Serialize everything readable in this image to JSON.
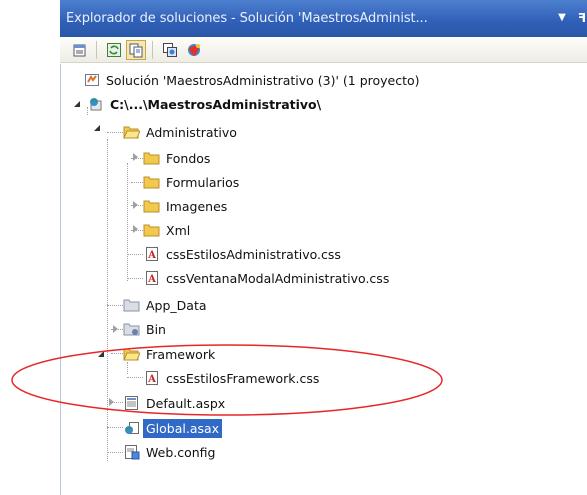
{
  "window": {
    "title": "Explorador de soluciones - Solución 'MaestrosAdminist...",
    "dropdown_icon": "dropdown-arrow-icon",
    "pin_icon": "pin-icon",
    "close_icon": "close-icon"
  },
  "toolbar": {
    "buttons": [
      {
        "icon": "properties-icon"
      },
      {
        "icon": "refresh-icon"
      },
      {
        "icon": "show-all-files-icon",
        "pressed": true
      },
      {
        "icon": "copy-website-icon"
      },
      {
        "icon": "asp-net-configuration-icon"
      }
    ]
  },
  "tree": {
    "solution": "Solución 'MaestrosAdministrativo (3)'  (1 proyecto)",
    "project": "C:\\...\\MaestrosAdministrativo\\",
    "administrativo": "Administrativo",
    "fondos": "Fondos",
    "formularios": "Formularios",
    "imagenes": "Imagenes",
    "xml": "Xml",
    "css_estilos_admin": "cssEstilosAdministrativo.css",
    "css_ventana_modal": "cssVentanaModalAdministrativo.css",
    "app_data": "App_Data",
    "bin": "Bin",
    "framework": "Framework",
    "css_estilos_framework": "cssEstilosFramework.css",
    "default_aspx": "Default.aspx",
    "global_asax": "Global.asax",
    "web_config": "Web.config"
  },
  "colors": {
    "titlebar": "#3a6cc4",
    "selection": "#3169c6",
    "annotation": "#e8262a",
    "folder": "#f2c94c"
  }
}
